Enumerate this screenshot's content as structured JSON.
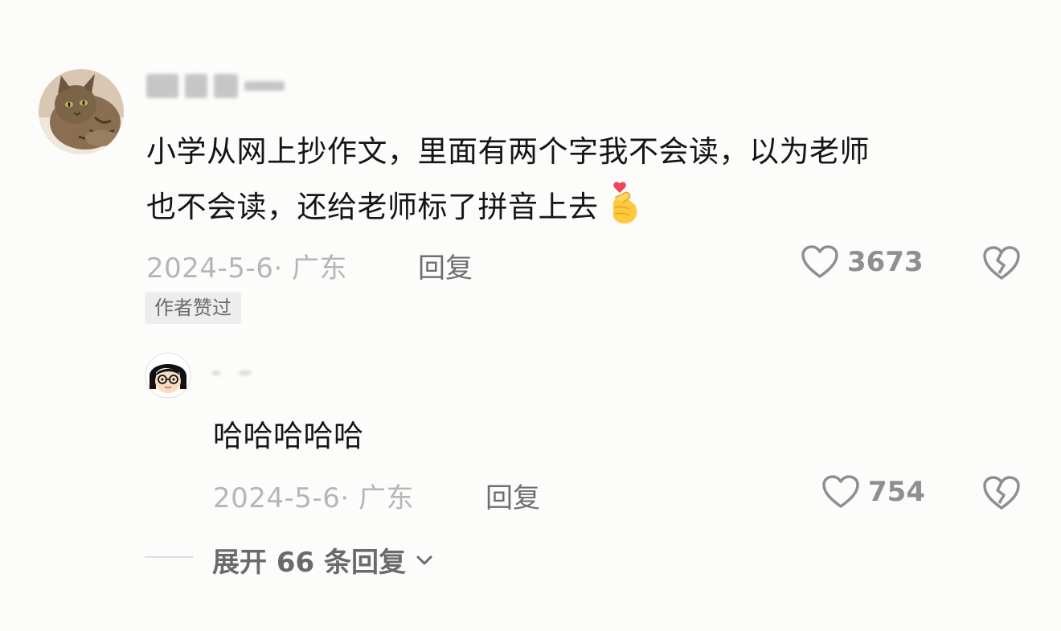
{
  "comment": {
    "text_line1": "小学从网上抄作文，里面有两个字我不会读，以为老师",
    "text_line2": "也不会读，还给老师标了拼音上去",
    "date_location": "2024-5-6· 广东",
    "reply_label": "回复",
    "like_count": "3673",
    "badge": "作者赞过",
    "emoji": "finger-heart-emoji"
  },
  "reply": {
    "text": "哈哈哈哈哈",
    "date_location": "2024-5-6· 广东",
    "reply_label": "回复",
    "like_count": "754"
  },
  "expand": {
    "label": "展开 66 条回复"
  },
  "icons": {
    "like": "heart-outline-icon",
    "dislike": "broken-heart-icon",
    "expand": "chevron-down-icon"
  },
  "colors": {
    "text_primary": "#151515",
    "text_meta": "#b6b6b6",
    "text_secondary": "#6e6e6e",
    "background": "#fcfcfb"
  }
}
